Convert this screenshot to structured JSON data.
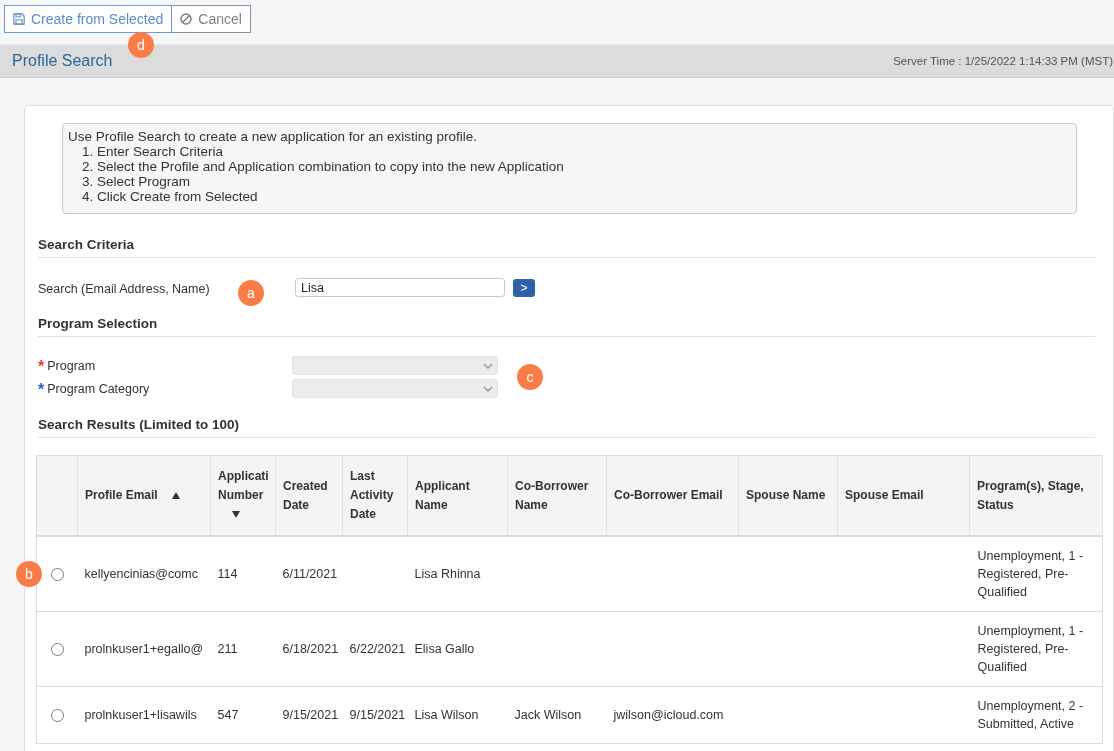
{
  "toolbar": {
    "buttons": [
      {
        "kind": "save",
        "label": "Create from Selected",
        "callout": "d"
      },
      {
        "kind": "cancel",
        "label": "Cancel"
      }
    ]
  },
  "header": {
    "title": "Profile Search",
    "server_time": "Server Time : 1/25/2022 1:14:33 PM (MST)"
  },
  "instructions": {
    "intro": "Use Profile Search to create a new application for an existing profile.",
    "steps": [
      "1. Enter Search Criteria",
      "2. Select the Profile and Application combination to copy into the new Application",
      "3. Select Program",
      "4. Click Create from Selected"
    ]
  },
  "search_criteria": {
    "heading": "Search Criteria",
    "label": "Search (Email Address, Name)",
    "value": "Lisa",
    "button": ">",
    "callout": "a"
  },
  "program_selection": {
    "heading": "Program Selection",
    "callout": "c",
    "fields": [
      {
        "label": "Program",
        "required_mark": "*",
        "color": "#e8412f",
        "disabled": true
      },
      {
        "label": "Program Category",
        "required_mark": "*",
        "color": "#3550d4",
        "disabled": true
      }
    ]
  },
  "search_results": {
    "heading": "Search Results (Limited to 100)",
    "columns": [
      {
        "label": "Profile Email",
        "sort_up": true,
        "sort_down": false
      },
      {
        "label": "Applicati Number",
        "sort_up": false,
        "sort_down": true
      },
      {
        "label": "Created Date",
        "sort_up": false,
        "sort_down": false
      },
      {
        "label": "Last Activity Date",
        "sort_up": false,
        "sort_down": false
      },
      {
        "label": "Applicant Name",
        "sort_up": false,
        "sort_down": false
      },
      {
        "label": "Co-Borrower Name",
        "sort_up": false,
        "sort_down": false
      },
      {
        "label": "Co-Borrower Email",
        "sort_up": false,
        "sort_down": false
      },
      {
        "label": "Spouse Name",
        "sort_up": false,
        "sort_down": false
      },
      {
        "label": "Spouse Email",
        "sort_up": false,
        "sort_down": false
      },
      {
        "label": "Program(s), Stage, Status",
        "sort_up": false,
        "sort_down": false
      }
    ],
    "rows": [
      {
        "selected": false,
        "callout": "b",
        "profile_email": "kellyencinias@comc",
        "application_number": "114",
        "created_date": "6/11/2021",
        "applicant_name": "Lisa Rhinna",
        "programs_stage_status": "Unemployment, 1 - Registered, Pre-Qualified"
      },
      {
        "selected": false,
        "profile_email": "prolnkuser1+egallo@",
        "application_number": "211",
        "created_date": "6/18/2021",
        "last_activity_date": "6/22/2021",
        "applicant_name": "Elisa Gallo",
        "programs_stage_status": "Unemployment, 1 - Registered, Pre-Qualified"
      },
      {
        "selected": false,
        "profile_email": "prolnkuser1+lisawils",
        "application_number": "547",
        "created_date": "9/15/2021",
        "last_activity_date": "9/15/2021",
        "applicant_name": "Lisa Wilson",
        "co_borrower_name": "Jack Wilson",
        "co_borrower_email": "jwilson@icloud.com",
        "programs_stage_status": "Unemployment, 2 - Submitted, Active"
      }
    ]
  }
}
